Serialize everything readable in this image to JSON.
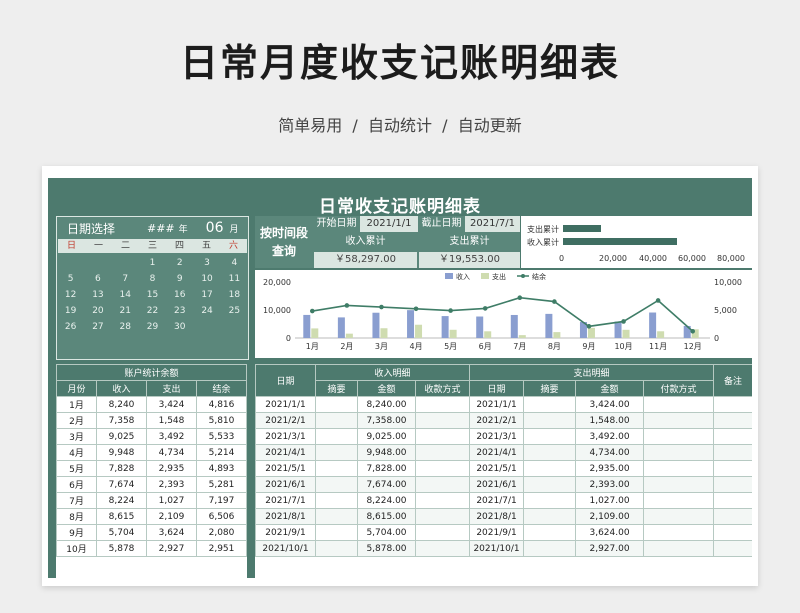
{
  "hero": {
    "title": "日常月度收支记账明细表",
    "subtitle": "简单易用  /  自动统计  /  自动更新"
  },
  "sheet": {
    "title": "日常收支记账明细表",
    "calendar": {
      "label": "日期选择",
      "year": "###",
      "year_unit": "年",
      "month": "06",
      "month_unit": "月",
      "weekdays": [
        "日",
        "一",
        "二",
        "三",
        "四",
        "五",
        "六"
      ],
      "rows": [
        [
          "",
          "",
          "",
          "1",
          "2",
          "3",
          "4"
        ],
        [
          "5",
          "6",
          "7",
          "8",
          "9",
          "10",
          "11"
        ],
        [
          "12",
          "13",
          "14",
          "15",
          "16",
          "17",
          "18"
        ],
        [
          "19",
          "20",
          "21",
          "22",
          "23",
          "24",
          "25"
        ],
        [
          "26",
          "27",
          "28",
          "29",
          "30",
          "",
          ""
        ]
      ]
    },
    "query": {
      "label_line1": "按时间段",
      "label_line2": "查询",
      "start_label": "开始日期",
      "start_value": "2021/1/1",
      "end_label": "截止日期",
      "end_value": "2021/7/1",
      "income_total_label": "收入累计",
      "income_total_value": "￥58,297.00",
      "expense_total_label": "支出累计",
      "expense_total_value": "￥19,553.00"
    },
    "summary_bars": {
      "labels": [
        "支出累计",
        "收入累计"
      ],
      "values": [
        19553,
        58297
      ],
      "axis_max": 80000,
      "axis_ticks": [
        "0",
        "20,000",
        "40,000",
        "60,000",
        "80,000"
      ]
    },
    "chart_data": {
      "type": "bar",
      "categories": [
        "1月",
        "2月",
        "3月",
        "4月",
        "5月",
        "6月",
        "7月",
        "8月",
        "9月",
        "10月",
        "11月",
        "12月"
      ],
      "series": [
        {
          "name": "收入",
          "type": "bar",
          "axis": "left",
          "values": [
            8240,
            7358,
            9025,
            9948,
            7828,
            7674,
            8224,
            8615,
            5704,
            5878,
            9100,
            4300
          ]
        },
        {
          "name": "支出",
          "type": "bar",
          "axis": "left",
          "values": [
            3424,
            1548,
            3492,
            4734,
            2935,
            2393,
            1027,
            2109,
            3624,
            2927,
            2400,
            3100
          ]
        },
        {
          "name": "结余",
          "type": "line",
          "axis": "right",
          "values": [
            4816,
            5810,
            5533,
            5214,
            4893,
            5281,
            7197,
            6506,
            2080,
            2951,
            6700,
            1200
          ]
        }
      ],
      "left_axis": {
        "min": 0,
        "max": 20000,
        "ticks": [
          "0",
          "10,000",
          "20,000"
        ]
      },
      "right_axis": {
        "min": 0,
        "max": 10000,
        "ticks": [
          "0",
          "5,000",
          "10,000"
        ]
      },
      "legend": "top-center",
      "colors": {
        "income": "#8a9ed0",
        "expense": "#cfdcb0",
        "balance": "#3f7d67"
      }
    },
    "account_table": {
      "caption": "账户统计余额",
      "headers": [
        "月份",
        "收入",
        "支出",
        "结余"
      ],
      "rows": [
        [
          "1月",
          "8,240",
          "3,424",
          "4,816"
        ],
        [
          "2月",
          "7,358",
          "1,548",
          "5,810"
        ],
        [
          "3月",
          "9,025",
          "3,492",
          "5,533"
        ],
        [
          "4月",
          "9,948",
          "4,734",
          "5,214"
        ],
        [
          "5月",
          "7,828",
          "2,935",
          "4,893"
        ],
        [
          "6月",
          "7,674",
          "2,393",
          "5,281"
        ],
        [
          "7月",
          "8,224",
          "1,027",
          "7,197"
        ],
        [
          "8月",
          "8,615",
          "2,109",
          "6,506"
        ],
        [
          "9月",
          "5,704",
          "3,624",
          "2,080"
        ],
        [
          "10月",
          "5,878",
          "2,927",
          "2,951"
        ]
      ]
    },
    "detail_table": {
      "date_header": "日期",
      "income_group": "收入明细",
      "expense_group": "支出明细",
      "note_header": "备注",
      "income_subheaders": [
        "摘要",
        "金额",
        "收款方式"
      ],
      "expense_subheaders": [
        "日期",
        "摘要",
        "金额",
        "付款方式"
      ],
      "rows": [
        {
          "date": "2021/1/1",
          "in_amount": "8,240.00",
          "out_date": "2021/1/1",
          "out_amount": "3,424.00"
        },
        {
          "date": "2021/2/1",
          "in_amount": "7,358.00",
          "out_date": "2021/2/1",
          "out_amount": "1,548.00"
        },
        {
          "date": "2021/3/1",
          "in_amount": "9,025.00",
          "out_date": "2021/3/1",
          "out_amount": "3,492.00"
        },
        {
          "date": "2021/4/1",
          "in_amount": "9,948.00",
          "out_date": "2021/4/1",
          "out_amount": "4,734.00"
        },
        {
          "date": "2021/5/1",
          "in_amount": "7,828.00",
          "out_date": "2021/5/1",
          "out_amount": "2,935.00"
        },
        {
          "date": "2021/6/1",
          "in_amount": "7,674.00",
          "out_date": "2021/6/1",
          "out_amount": "2,393.00"
        },
        {
          "date": "2021/7/1",
          "in_amount": "8,224.00",
          "out_date": "2021/7/1",
          "out_amount": "1,027.00"
        },
        {
          "date": "2021/8/1",
          "in_amount": "8,615.00",
          "out_date": "2021/8/1",
          "out_amount": "2,109.00"
        },
        {
          "date": "2021/9/1",
          "in_amount": "5,704.00",
          "out_date": "2021/9/1",
          "out_amount": "3,624.00"
        },
        {
          "date": "2021/10/1",
          "in_amount": "5,878.00",
          "out_date": "2021/10/1",
          "out_amount": "2,927.00"
        }
      ]
    }
  }
}
